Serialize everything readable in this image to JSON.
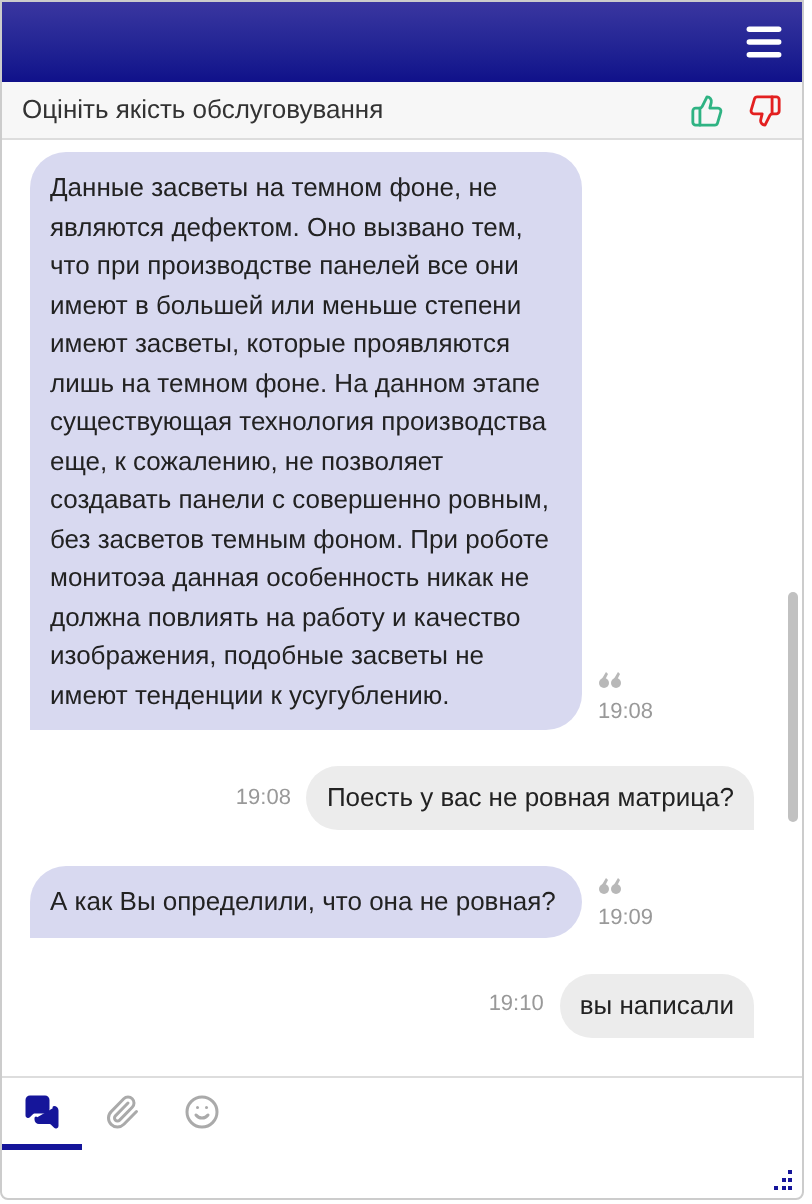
{
  "rating": {
    "label": "Оцініть якість обслуговування"
  },
  "messages": [
    {
      "kind": "incoming",
      "text": "Данные засветы на темном фоне, не являются дефектом. Оно вызвано тем, что при производстве панелей все они имеют в большей или меньше степени имеют засветы, которые проявляются лишь на темном фоне. На данном этапе существующая технология производства еще, к сожалению, не позволяет создавать панели с совершенно ровным, без засветов темным фоном. При роботе монитоэа данная особенность никак не должна повлиять на работу и качество изображения, подобные засветы не имеют тенденции к усугублению.",
      "time": "19:08"
    },
    {
      "kind": "outgoing",
      "text": "Поесть у вас не ровная матрица?",
      "time": "19:08"
    },
    {
      "kind": "incoming",
      "text": "А как Вы определили, что она не ровная?",
      "time": "19:09"
    },
    {
      "kind": "outgoing",
      "text": "вы написали",
      "time": "19:10"
    }
  ],
  "tabs": [
    {
      "kind": "chat",
      "selected": true
    },
    {
      "kind": "attach",
      "selected": false
    },
    {
      "kind": "emoji",
      "selected": false
    }
  ]
}
